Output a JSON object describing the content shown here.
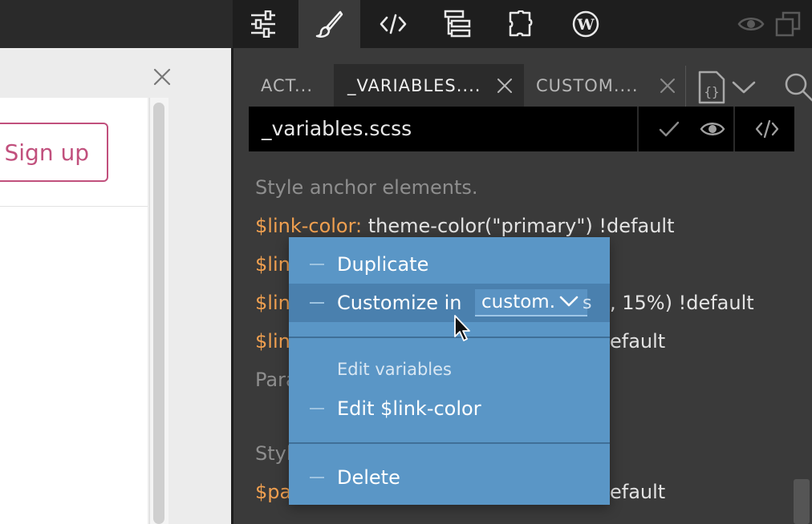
{
  "toolbar": {
    "buttons": [
      {
        "name": "settings-sliders-icon"
      },
      {
        "name": "paintbrush-icon",
        "active": true
      },
      {
        "name": "code-icon"
      },
      {
        "name": "tree-icon"
      },
      {
        "name": "puzzle-icon"
      },
      {
        "name": "wordpress-icon"
      }
    ],
    "right": [
      {
        "name": "eye-icon"
      },
      {
        "name": "windows-icon"
      }
    ]
  },
  "preview": {
    "signup_label": "Sign up"
  },
  "tabs": [
    {
      "label": "ACT...",
      "active": false
    },
    {
      "label": "_VARIABLES....",
      "active": true
    },
    {
      "label": "CUSTOM....",
      "active": false
    }
  ],
  "filebar": {
    "filename": "_variables.scss"
  },
  "code_lines": [
    {
      "type": "comment",
      "text": "Style anchor elements."
    },
    {
      "type": "decl",
      "var": "$link-color:",
      "value": " theme-color(\"primary\") !default"
    },
    {
      "type": "partial",
      "var": "$lin",
      "value": ""
    },
    {
      "type": "partial",
      "var": "$lin",
      "value": ", 15%) !default"
    },
    {
      "type": "partial",
      "var": "$lin",
      "value": "efault"
    },
    {
      "type": "comment",
      "text": "Para"
    },
    {
      "type": "comment",
      "text": "Styl"
    },
    {
      "type": "partial",
      "var": "$pa",
      "value": "efault"
    }
  ],
  "context_menu": {
    "duplicate": "Duplicate",
    "customize_in": "Customize in",
    "customize_target": "custom.",
    "customize_target_tail": "s",
    "edit_variables_header": "Edit variables",
    "edit_link_color": "Edit $link-color",
    "delete": "Delete"
  },
  "colors": {
    "accent": "#c1507d",
    "menu_bg": "#5a96c6",
    "variable": "#f0a050"
  }
}
